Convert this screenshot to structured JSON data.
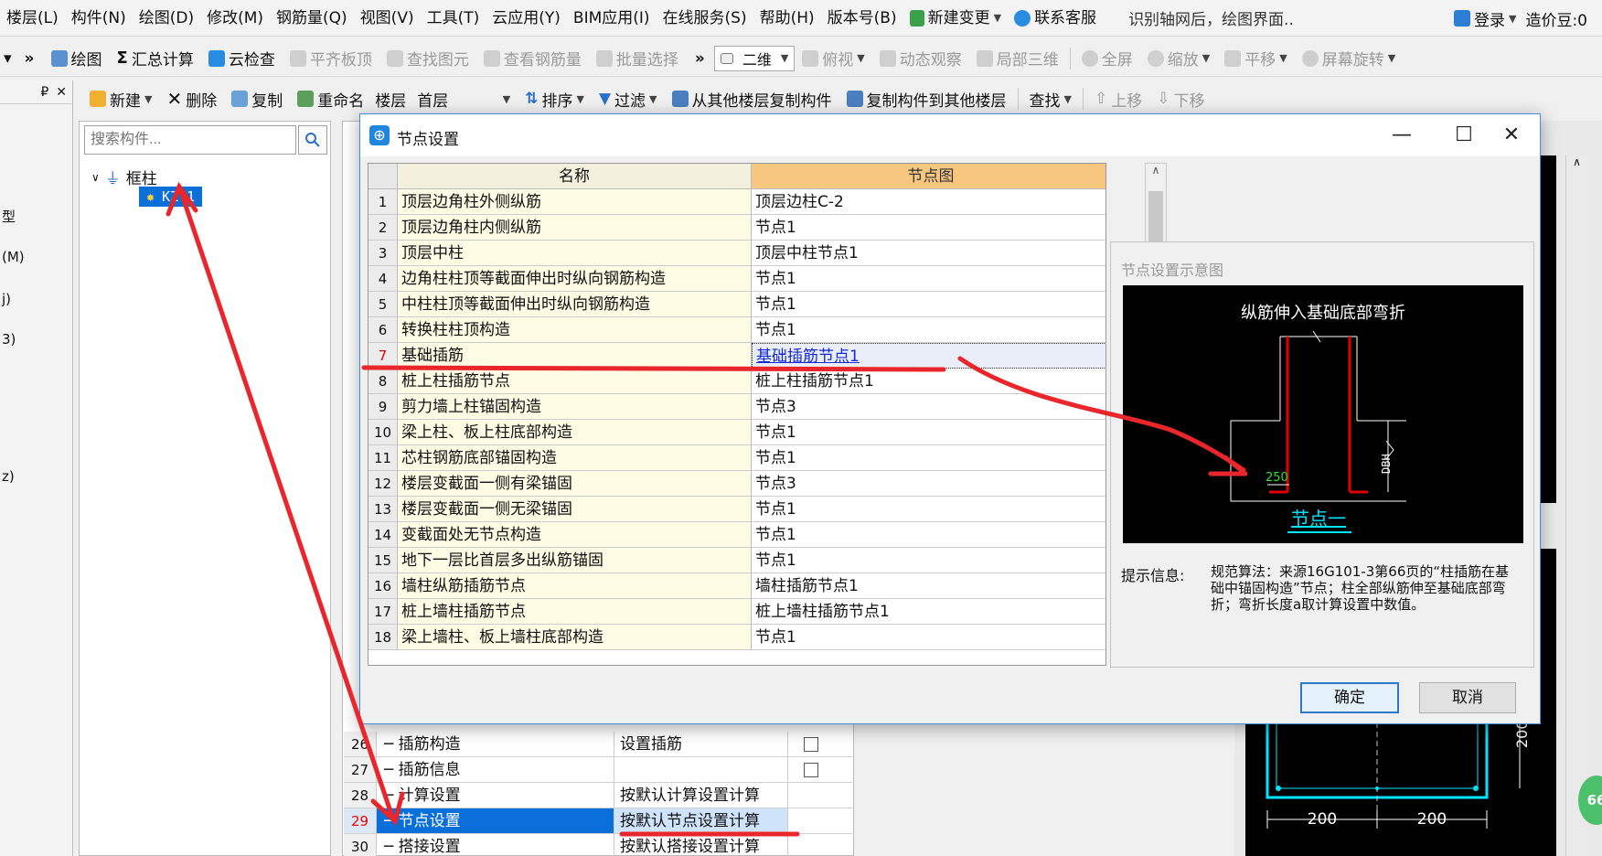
{
  "menu": {
    "items": [
      "楼层(L)",
      "构件(N)",
      "绘图(D)",
      "修改(M)",
      "钢筋量(Q)",
      "视图(V)",
      "工具(T)",
      "云应用(Y)",
      "BIM应用(I)",
      "在线服务(S)",
      "帮助(H)",
      "版本号(B)"
    ],
    "new_change": "新建变更",
    "support": "联系客服",
    "notice": "识别轴网后，绘图界面..",
    "login": "登录",
    "cost_beans": "造价豆:0"
  },
  "toolbar1": {
    "draw": "绘图",
    "sum_calc": "汇总计算",
    "cloud_check": "云检查",
    "level_slab_top": "平齐板顶",
    "find_element": "查找图元",
    "view_rebar": "查看钢筋量",
    "batch_select": "批量选择",
    "view_mode": "二维",
    "top_view": "俯视",
    "dynamic_observe": "动态观察",
    "local_3d": "局部三维",
    "full_screen": "全屏",
    "zoom": "缩放",
    "pan": "平移",
    "rotate_screen": "屏幕旋转"
  },
  "toolbar2": {
    "new": "新建",
    "delete": "删除",
    "copy": "复制",
    "rename": "重命名",
    "floor_label": "楼层",
    "floor_value": "首层",
    "sort": "排序",
    "filter": "过滤",
    "copy_from_floor": "从其他楼层复制构件",
    "copy_to_floor": "复制构件到其他楼层",
    "find": "查找",
    "move_up": "上移",
    "move_down": "下移"
  },
  "left_strip": [
    "型",
    "(M)",
    "j)",
    "3)",
    "z)"
  ],
  "tree": {
    "search_placeholder": "搜索构件...",
    "category": "框柱",
    "item": "KZ-1"
  },
  "props": {
    "rows": [
      {
        "num": "26",
        "name": "插筋构造",
        "value": "设置插筋",
        "check": true
      },
      {
        "num": "27",
        "name": "插筋信息",
        "value": "",
        "check": true
      },
      {
        "num": "28",
        "name": "计算设置",
        "value": "按默认计算设置计算",
        "check": false
      },
      {
        "num": "29",
        "name": "节点设置",
        "value": "按默认节点设置计算",
        "check": false
      },
      {
        "num": "30",
        "name": "搭接设置",
        "value": "按默认搭接设置计算",
        "check": false
      }
    ]
  },
  "dialog": {
    "title": "节点设置",
    "col_name": "名称",
    "col_diagram": "节点图",
    "rows": [
      {
        "num": "1",
        "name": "顶层边角柱外侧纵筋",
        "diagram": "顶层边柱C-2"
      },
      {
        "num": "2",
        "name": "顶层边角柱内侧纵筋",
        "diagram": "节点1"
      },
      {
        "num": "3",
        "name": "顶层中柱",
        "diagram": "顶层中柱节点1"
      },
      {
        "num": "4",
        "name": "边角柱柱顶等截面伸出时纵向钢筋构造",
        "diagram": "节点1"
      },
      {
        "num": "5",
        "name": "中柱柱顶等截面伸出时纵向钢筋构造",
        "diagram": "节点1"
      },
      {
        "num": "6",
        "name": "转换柱柱顶构造",
        "diagram": "节点1"
      },
      {
        "num": "7",
        "name": "基础插筋",
        "diagram": "基础插筋节点1"
      },
      {
        "num": "8",
        "name": "桩上柱插筋节点",
        "diagram": "桩上柱插筋节点1"
      },
      {
        "num": "9",
        "name": "剪力墙上柱锚固构造",
        "diagram": "节点3"
      },
      {
        "num": "10",
        "name": "梁上柱、板上柱底部构造",
        "diagram": "节点1"
      },
      {
        "num": "11",
        "name": "芯柱钢筋底部锚固构造",
        "diagram": "节点1"
      },
      {
        "num": "12",
        "name": "楼层变截面一侧有梁锚固",
        "diagram": "节点3"
      },
      {
        "num": "13",
        "name": "楼层变截面一侧无梁锚固",
        "diagram": "节点1"
      },
      {
        "num": "14",
        "name": "变截面处无节点构造",
        "diagram": "节点1"
      },
      {
        "num": "15",
        "name": "地下一层比首层多出纵筋锚固",
        "diagram": "节点1"
      },
      {
        "num": "16",
        "name": "墙柱纵筋插筋节点",
        "diagram": "墙柱插筋节点1"
      },
      {
        "num": "17",
        "name": "桩上墙柱插筋节点",
        "diagram": "桩上墙柱插筋节点1"
      },
      {
        "num": "18",
        "name": "梁上墙柱、板上墙柱底部构造",
        "diagram": "节点1"
      }
    ],
    "diagram_panel_title": "节点设置示意图",
    "diagram_caption": "纵筋伸入基础底部弯折",
    "diagram_dim_250": "250",
    "diagram_dim_dbh": "DBH",
    "diagram_node_label": "节点一",
    "hint_label": "提示信息:",
    "hint_text": "规范算法：来源16G101-3第66页的“柱插筋在基础中锚固构造”节点；柱全部纵筋伸至基础底部弯折；弯折长度a取计算设置中数值。",
    "ok": "确定",
    "cancel": "取消"
  },
  "drawing": {
    "dim_left": "200",
    "dim_right": "200",
    "dim_vertical": "200"
  },
  "badge": "66",
  "colors": {
    "selection_blue": "#0a6fd8",
    "header_orange": "#f7c780",
    "name_col_yellow": "#fdfbe3",
    "annotation_red": "#e8262b",
    "rebar_red": "#e00000",
    "cad_cyan": "#00e5ff"
  }
}
